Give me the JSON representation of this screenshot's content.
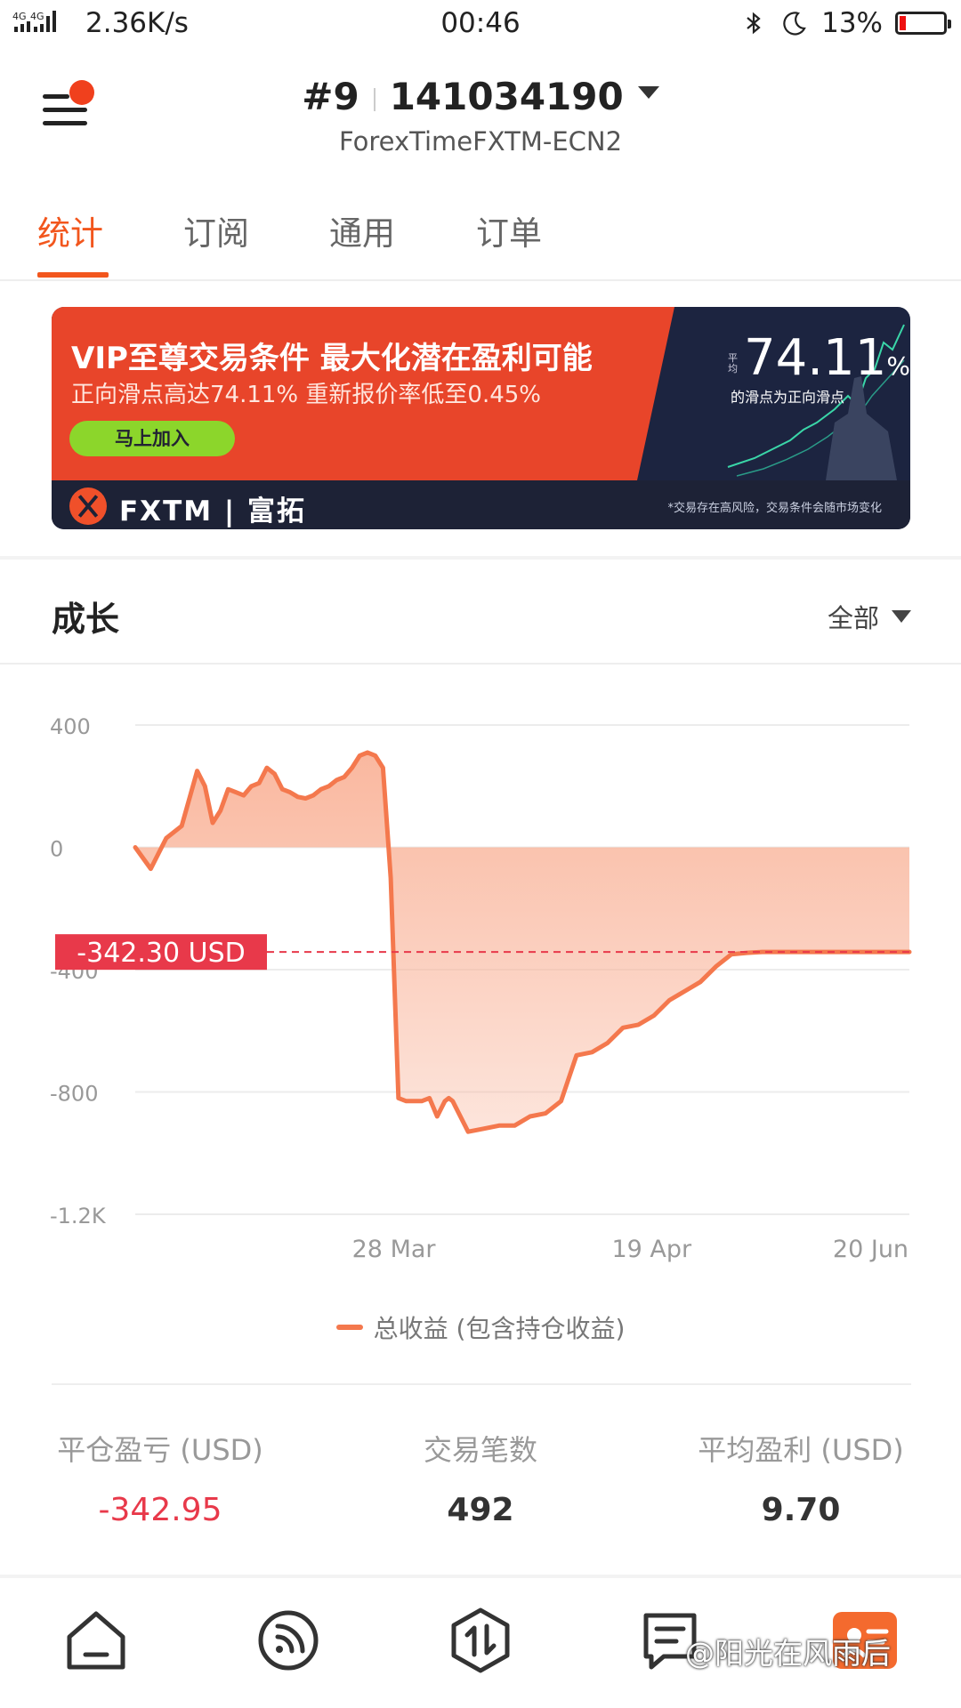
{
  "status_bar": {
    "network": "4G 4G",
    "speed": "2.36K/s",
    "time": "00:46",
    "battery": "13%",
    "battery_level": 0.13
  },
  "header": {
    "account_index": "#9",
    "account_number": "141034190",
    "broker": "ForexTimeFXTM-ECN2"
  },
  "tabs": [
    {
      "label": "统计",
      "active": true
    },
    {
      "label": "订阅",
      "active": false
    },
    {
      "label": "通用",
      "active": false
    },
    {
      "label": "订单",
      "active": false
    }
  ],
  "banner": {
    "title": "VIP至尊交易条件 最大化潜在盈利可能",
    "subtitle": "正向滑点高达74.11% 重新报价率低至0.45%",
    "cta": "马上加入",
    "brand": "FXTM | 富拓",
    "stat_prefix": "平均",
    "stat_value": "74.11",
    "stat_unit": "%",
    "stat_desc": "的滑点为正向滑点",
    "disclaimer": "*交易存在高风险，交易条件会随市场变化"
  },
  "growth": {
    "title": "成长",
    "filter": "全部"
  },
  "chart_data": {
    "type": "area",
    "y_ticks": [
      "400",
      "0",
      "-400",
      "-800",
      "-1.2K"
    ],
    "ylim": [
      -1200,
      400
    ],
    "x_ticks": [
      {
        "label": "28 Mar",
        "x": 0.334
      },
      {
        "label": "19 Apr",
        "x": 0.667
      },
      {
        "label": "20 Jun",
        "x": 0.95
      }
    ],
    "x": [
      0.0,
      0.02,
      0.04,
      0.06,
      0.08,
      0.09,
      0.1,
      0.11,
      0.12,
      0.13,
      0.14,
      0.15,
      0.16,
      0.17,
      0.18,
      0.19,
      0.2,
      0.21,
      0.22,
      0.23,
      0.24,
      0.25,
      0.26,
      0.27,
      0.28,
      0.29,
      0.3,
      0.31,
      0.32,
      0.33,
      0.34,
      0.35,
      0.36,
      0.37,
      0.38,
      0.39,
      0.4,
      0.405,
      0.41,
      0.43,
      0.45,
      0.47,
      0.49,
      0.51,
      0.53,
      0.55,
      0.57,
      0.59,
      0.61,
      0.63,
      0.65,
      0.67,
      0.69,
      0.71,
      0.73,
      0.75,
      0.77,
      0.79,
      0.81,
      0.83,
      0.85,
      0.87,
      0.89,
      0.91,
      0.93,
      0.95,
      0.97,
      1.0
    ],
    "values": [
      0,
      -70,
      30,
      70,
      250,
      200,
      80,
      120,
      190,
      180,
      170,
      200,
      210,
      260,
      240,
      190,
      180,
      165,
      160,
      170,
      190,
      200,
      220,
      230,
      260,
      300,
      310,
      300,
      260,
      -100,
      -820,
      -830,
      -830,
      -830,
      -820,
      -880,
      -830,
      -820,
      -830,
      -930,
      -920,
      -910,
      -910,
      -880,
      -870,
      -830,
      -680,
      -670,
      -640,
      -590,
      -580,
      -550,
      -500,
      -470,
      -440,
      -390,
      -350,
      -345,
      -342,
      -342,
      -342,
      -342,
      -342,
      -342,
      -342,
      -342,
      -342,
      -342
    ],
    "current_value": -342.3,
    "current_label": "-342.30 USD",
    "legend": "总收益 (包含持仓收益)",
    "colors": {
      "line": "#f4784d",
      "fill": "#f9b49a",
      "marker": "#e8394a"
    }
  },
  "stats": [
    {
      "label": "平仓盈亏 (USD)",
      "value": "-342.95",
      "negative": true
    },
    {
      "label": "交易笔数",
      "value": "492",
      "negative": false
    },
    {
      "label": "平均盈利 (USD)",
      "value": "9.70",
      "negative": false
    }
  ],
  "bottom_nav": [
    {
      "name": "home-icon"
    },
    {
      "name": "signal-icon"
    },
    {
      "name": "trade-icon"
    },
    {
      "name": "news-icon"
    },
    {
      "name": "profile-icon"
    }
  ],
  "watermark": "@阳光在风雨后"
}
